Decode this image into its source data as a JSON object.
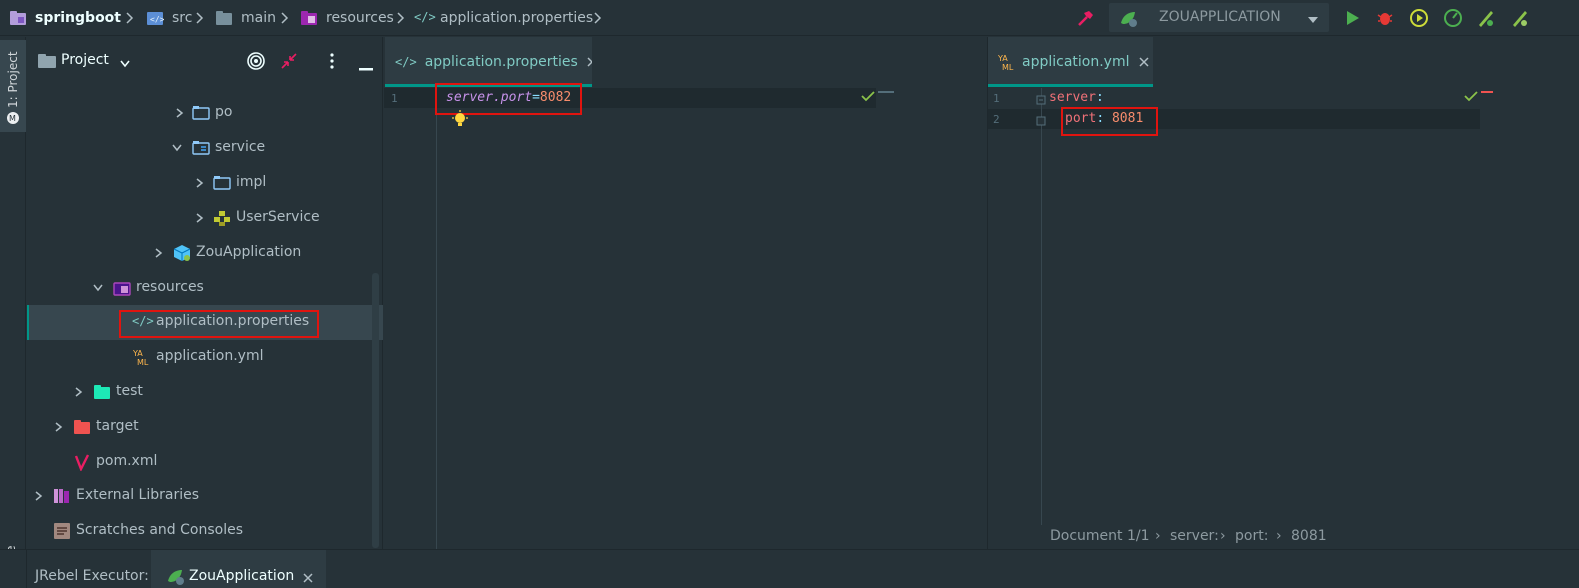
{
  "navbar": {
    "crumbs": [
      "springboot",
      "src",
      "main",
      "resources",
      "application.properties"
    ],
    "run_config": "ZOUAPPLICATION"
  },
  "left_stripe": {
    "project_label": "1: Project",
    "structure_label": "ucture"
  },
  "panel": {
    "title": "Project"
  },
  "tree": [
    {
      "label": "po"
    },
    {
      "label": "service"
    },
    {
      "label": "impl"
    },
    {
      "label": "UserService"
    },
    {
      "label": "ZouApplication"
    },
    {
      "label": "resources"
    },
    {
      "label": "application.properties"
    },
    {
      "label": "application.yml"
    },
    {
      "label": "test"
    },
    {
      "label": "target"
    },
    {
      "label": "pom.xml"
    },
    {
      "label": "External Libraries"
    },
    {
      "label": "Scratches and Consoles"
    }
  ],
  "editor_left": {
    "tab": "application.properties",
    "line1_num": "1",
    "key": "server.port",
    "eq": "=",
    "value": "8082"
  },
  "editor_right": {
    "tab": "application.yml",
    "line1_num": "1",
    "line2_num": "2",
    "line1_key": "server",
    "line1_colon": ":",
    "line2_key": "port",
    "line2_colon": ":",
    "line2_value": "8081",
    "status": {
      "doc": "Document 1/1",
      "path1": "server:",
      "path2": "port:",
      "path3": "8081"
    }
  },
  "bottom": {
    "label": "JRebel Executor:",
    "tab": "ZouApplication"
  },
  "colors": {
    "accent": "#009688",
    "highlight_box": "#e0140f",
    "key_purple": "#c792ea",
    "value_orange": "#f78c6c",
    "yaml_key": "#f07178"
  }
}
